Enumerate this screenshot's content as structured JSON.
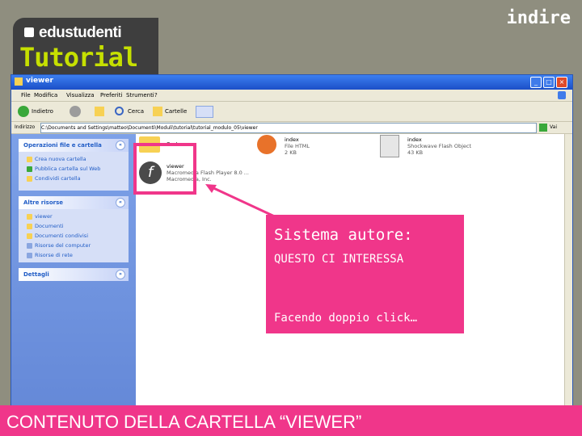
{
  "header": {
    "brand": "edustudenti",
    "title": "Tutorial",
    "logo_text": "indire"
  },
  "window": {
    "title": "viewer",
    "menu": [
      "File",
      "Modifica",
      "Visualizza",
      "Preferiti",
      "Strumenti",
      "?"
    ],
    "toolbar": {
      "back": "Indietro",
      "search": "Cerca",
      "folders": "Cartelle"
    },
    "address_label": "Indirizzo",
    "address_value": "C:\\Documents and Settings\\matteo\\Documenti\\Moduli\\tutorial\\tutorial_modulo_05\\viewer",
    "go_label": "Vai"
  },
  "left_pane": {
    "tasks": {
      "title": "Operazioni file e cartella",
      "items": [
        "Crea nuova cartella",
        "Pubblica cartella sul Web",
        "Condividi cartella"
      ]
    },
    "places": {
      "title": "Altre risorse",
      "items": [
        "viewer",
        "Documenti",
        "Documenti condivisi",
        "Risorse del computer",
        "Risorse di rete"
      ]
    },
    "details": {
      "title": "Dettagli"
    }
  },
  "files": [
    {
      "name": "flash",
      "type": "",
      "size": ""
    },
    {
      "name": "index",
      "type": "File HTML",
      "size": "2 KB"
    },
    {
      "name": "index",
      "type": "Shockwave Flash Object",
      "size": "43 KB"
    },
    {
      "name": "viewer",
      "type": "Macromedia Flash Player 8.0 ...",
      "size": "Macromedia, Inc."
    }
  ],
  "callout": {
    "heading": "Sistema autore:",
    "subheading": "QUESTO CI INTERESSA",
    "caption": "Facendo doppio click…"
  },
  "footer": {
    "text": "CONTENUTO DELLA CARTELLA “VIEWER”"
  },
  "colors": {
    "accent": "#f0368a",
    "brand_green": "#c6e000",
    "xp_blue": "#215dc6"
  }
}
